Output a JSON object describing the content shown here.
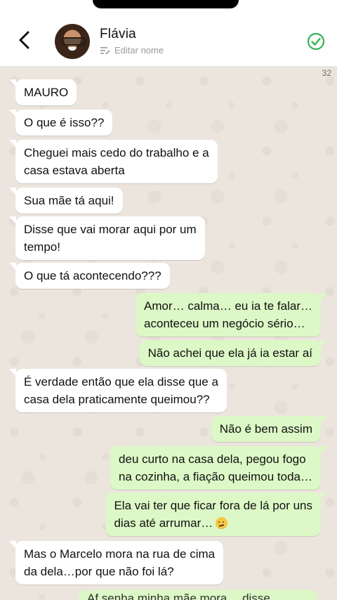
{
  "header": {
    "contact_name": "Flávia",
    "edit_label": "Editar nome"
  },
  "chat": {
    "message_count": "32",
    "messages": [
      {
        "dir": "in",
        "text": "MAURO"
      },
      {
        "dir": "in",
        "text": "O que é isso??"
      },
      {
        "dir": "in",
        "lines": [
          "Cheguei mais cedo do trabalho e a",
          "casa estava aberta"
        ]
      },
      {
        "dir": "in",
        "text": "Sua mãe tá aqui!"
      },
      {
        "dir": "in",
        "lines": [
          "Disse que vai morar aqui por um",
          "tempo!"
        ]
      },
      {
        "dir": "in",
        "text": "O que tá acontecendo???"
      },
      {
        "dir": "out",
        "lines": [
          "Amor… calma… eu ia te falar…",
          "aconteceu um negócio sério…"
        ]
      },
      {
        "dir": "out",
        "text": "Não achei que ela já ia estar aí"
      },
      {
        "dir": "in",
        "lines": [
          "É verdade então que ela disse que a",
          "casa dela praticamente queimou??"
        ]
      },
      {
        "dir": "out",
        "text": "Não é bem assim"
      },
      {
        "dir": "out",
        "lines": [
          "deu curto na casa dela, pegou fogo",
          "na cozinha, a fiação queimou toda…"
        ]
      },
      {
        "dir": "out",
        "lines": [
          "Ela vai ter que ficar fora de lá por uns",
          "dias até arrumar…"
        ],
        "emoji": "confused-face"
      },
      {
        "dir": "in",
        "lines": [
          "Mas o Marcelo mora na rua de cima",
          "da dela…por que não foi lá?"
        ]
      }
    ],
    "partial_text": "Af senha minha mãe mora… disse"
  },
  "colors": {
    "incoming": "#ffffff",
    "outgoing": "#dcf8c6",
    "chat_bg": "#ece5dd",
    "check": "#34b255"
  }
}
